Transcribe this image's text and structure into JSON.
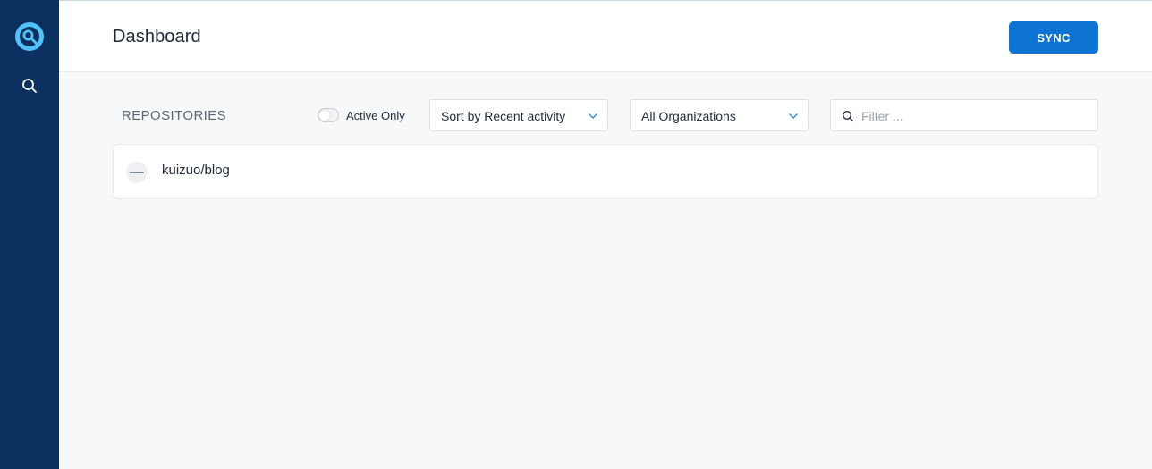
{
  "app": {
    "title": "Dashboard",
    "sync_label": "SYNC",
    "accent": "#0e74d4",
    "sidebar_color": "#0b2f5e"
  },
  "sidebar": {
    "items": [
      {
        "icon": "logo-icon"
      },
      {
        "icon": "search-icon"
      }
    ]
  },
  "toolbar": {
    "heading": "REPOSITORIES",
    "active_only_label": "Active Only",
    "active_only_on": false,
    "sort_value": "Sort by Recent activity",
    "org_value": "All Organizations",
    "filter_placeholder": "Filter ..."
  },
  "repositories": [
    {
      "name": "kuizuo/blog",
      "status": "inactive"
    }
  ]
}
